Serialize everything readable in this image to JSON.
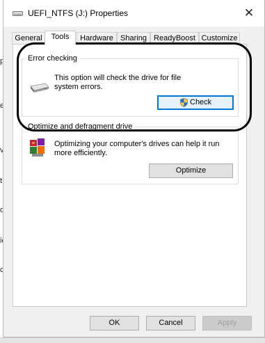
{
  "background": {
    "left_edge_chars": [
      "p",
      "el",
      "v",
      "t",
      "d",
      "ic",
      "c"
    ]
  },
  "window": {
    "title": "UEFI_NTFS (J:) Properties",
    "close_glyph": "✕"
  },
  "tabs": [
    {
      "label": "General"
    },
    {
      "label": "Tools",
      "active": true
    },
    {
      "label": "Hardware"
    },
    {
      "label": "Sharing"
    },
    {
      "label": "ReadyBoost"
    },
    {
      "label": "Customize"
    }
  ],
  "error_checking": {
    "title": "Error checking",
    "description_line1": "This option will check the drive for file",
    "description_line2": "system errors.",
    "check_button": "Check",
    "icon": "drive-icon",
    "button_icon": "uac-shield-icon"
  },
  "optimize": {
    "title": "Optimize and defragment drive",
    "description_line1": "Optimizing your computer's drives can help it run",
    "description_line2": "more efficiently.",
    "optimize_button": "Optimize",
    "icon": "defrag-icon"
  },
  "footer": {
    "ok": "OK",
    "cancel": "Cancel",
    "apply": "Apply"
  },
  "colors": {
    "focus_border": "#0078d7",
    "annotation": "#000000"
  }
}
